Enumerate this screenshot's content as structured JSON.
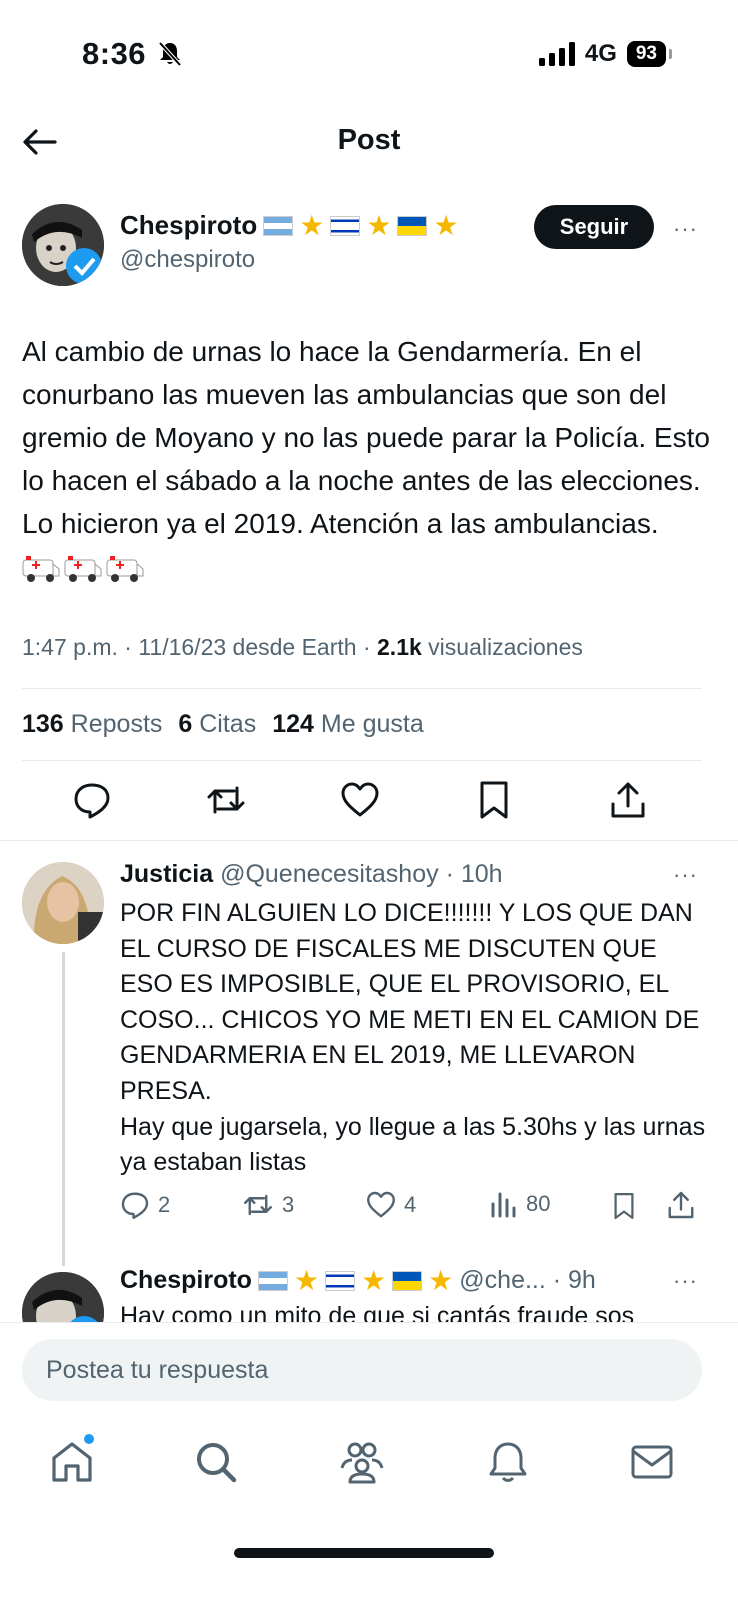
{
  "status_bar": {
    "time": "8:36",
    "network": "4G",
    "battery": "93",
    "icons": [
      "bell-slash-icon",
      "signal-icon",
      "battery-icon"
    ]
  },
  "header": {
    "title": "Post",
    "back_icon": "arrow-left-icon"
  },
  "post": {
    "author_name": "Chespiroto",
    "author_badges": [
      "argentina-flag",
      "star",
      "israel-flag",
      "star",
      "ukraine-flag",
      "star"
    ],
    "handle": "@chespiroto",
    "follow_label": "Seguir",
    "more": "···",
    "text": "Al cambio de urnas lo hace la Gendarmería. En el conurbano las mueven las ambulancias que son del gremio de Moyano y no las puede parar la Policía. Esto lo hacen el sábado a la noche antes de las elecciones. Lo hicieron ya el 2019. Atención a las ambulancias.",
    "meta_prefix": "1:47 p.m. · 11/16/23 desde Earth · ",
    "views_count": "2.1k",
    "views_label": " visualizaciones",
    "stats": {
      "reposts_count": "136",
      "reposts_label": "Reposts",
      "quotes_count": "6",
      "quotes_label": "Citas",
      "likes_count": "124",
      "likes_label": "Me gusta"
    },
    "actions": [
      "reply-icon",
      "repost-icon",
      "like-icon",
      "bookmark-icon",
      "share-icon"
    ]
  },
  "reply": {
    "author_name": "Justicia",
    "handle_time": "@Quenecesitashoy · 10h",
    "more": "···",
    "text": "POR FIN ALGUIEN LO DICE!!!!!!! Y LOS QUE DAN EL CURSO DE FISCALES ME DISCUTEN QUE ESO ES IMPOSIBLE, QUE EL PROVISORIO, EL COSO... CHICOS YO ME METI EN EL CAMION DE GENDARMERIA EN EL 2019, ME LLEVARON PRESA.\nHay que jugarsela, yo llegue a las 5.30hs y las urnas ya estaban listas",
    "replies": "2",
    "reposts": "3",
    "likes": "4",
    "views": "80"
  },
  "reply2": {
    "author_name": "Chespiroto",
    "handle_time": "@che... · 9h",
    "more": "···",
    "text": "Hay como un mito de que si cantás fraude sos"
  },
  "composer": {
    "placeholder": "Postea tu respuesta"
  },
  "tabbar": {
    "tabs": [
      "home-icon",
      "search-icon",
      "communities-icon",
      "notifications-icon",
      "messages-icon"
    ]
  }
}
